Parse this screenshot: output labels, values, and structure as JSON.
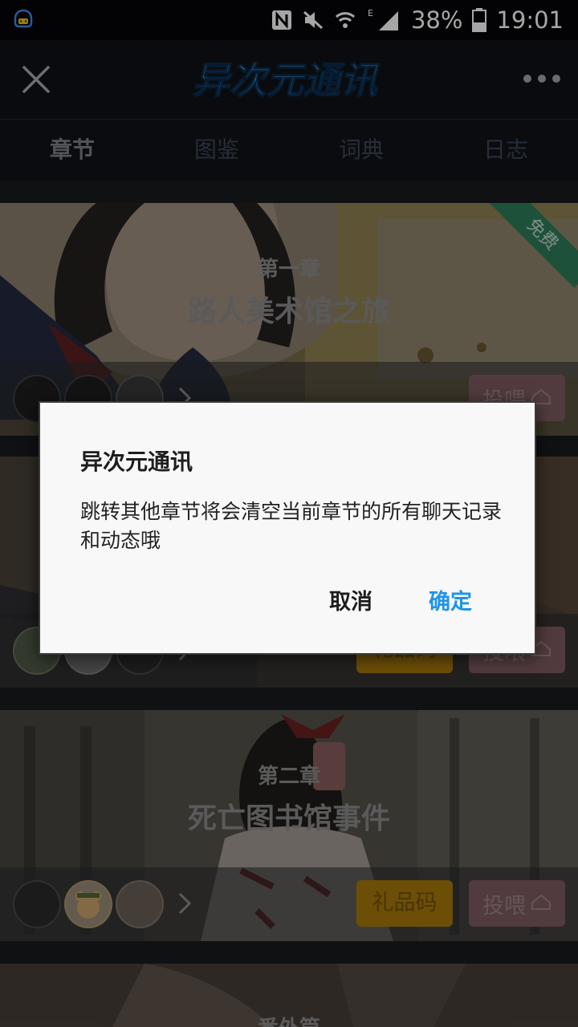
{
  "status_bar": {
    "battery_percent": "38%",
    "time": "19:01",
    "network_type": "E",
    "icons": [
      "qq-notification-icon",
      "nfc-icon",
      "mute-icon",
      "wifi-icon",
      "signal-icon",
      "battery-icon"
    ]
  },
  "header": {
    "logo_text": "异次元通讯",
    "close_icon": "close-icon",
    "more_icon": "more-icon"
  },
  "tabs": [
    {
      "label": "章节",
      "active": true
    },
    {
      "label": "图鉴",
      "active": false
    },
    {
      "label": "词典",
      "active": false
    },
    {
      "label": "日志",
      "active": false
    }
  ],
  "chapters": [
    {
      "number": "第一章",
      "title": "路人美术馆之旅",
      "badge": "免费",
      "feed_label": "投喂"
    },
    {
      "gift_label": "礼品码",
      "feed_label": "投喂"
    },
    {
      "number": "第二章",
      "title": "死亡图书馆事件",
      "gift_label": "礼品码",
      "feed_label": "投喂"
    },
    {
      "number": "番外篇"
    }
  ],
  "dialog": {
    "title": "异次元通讯",
    "message": "跳转其他章节将会清空当前章节的所有聊天记录和动态哦",
    "cancel_label": "取消",
    "confirm_label": "确定"
  },
  "colors": {
    "confirm_blue": "#1f94e8",
    "gift_gold": "#a8780a",
    "feed_pink": "#7e5b60",
    "free_green": "#2e7d5a"
  }
}
